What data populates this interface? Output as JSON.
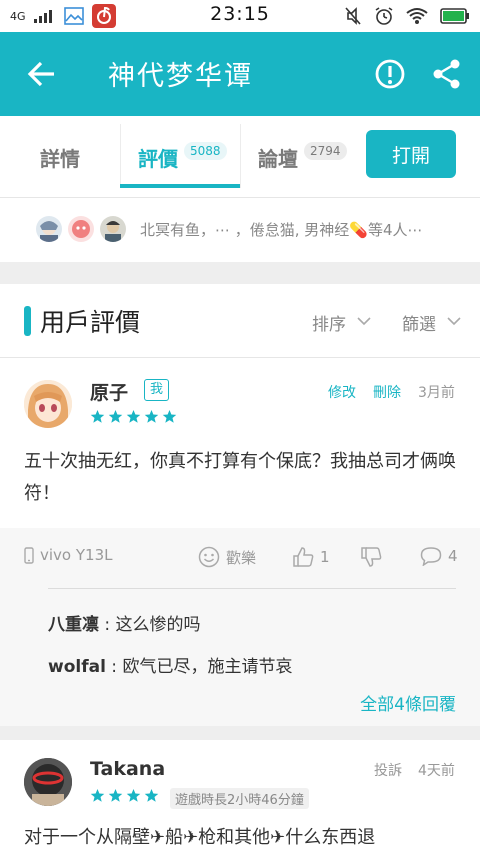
{
  "status_bar": {
    "network": "4G",
    "time": "23:15"
  },
  "header": {
    "title": "神代梦华谭"
  },
  "tabs": [
    {
      "label": "詳情",
      "count": ""
    },
    {
      "label": "評價",
      "count": "5088"
    },
    {
      "label": "論壇",
      "count": "2794"
    }
  ],
  "open_button": "打開",
  "likers": {
    "text": "北冥有鱼，⋯ ，倦怠猫, 男神经💊等4人⋯"
  },
  "section": {
    "title": "用戶評價",
    "sort_label": "排序",
    "filter_label": "篩選"
  },
  "review1": {
    "name": "原子",
    "badge": "我",
    "edit": "修改",
    "delete": "刪除",
    "time": "3月前",
    "stars": 5,
    "body": "五十次抽无红，你真不打算有个保底？我抽总司才俩唤符！",
    "device": "vivo Y13L",
    "reaction_label": "歡樂",
    "likes": "1",
    "comments": "4",
    "replies": [
      {
        "author": "八重凛",
        "text": " : 这么惨的吗"
      },
      {
        "author": "wolfal",
        "text": " : 欧气已尽，施主请节哀"
      }
    ],
    "all_replies": "全部4條回覆"
  },
  "review2": {
    "name": "Takana",
    "report": "投訴",
    "time": "4天前",
    "stars": 4,
    "playtime": "遊戲時長2小時46分鐘",
    "body": "对于一个从隔壁✈船✈枪和其他✈什么东西退"
  },
  "colors": {
    "accent": "#19b5c4",
    "gray": "#999999"
  }
}
